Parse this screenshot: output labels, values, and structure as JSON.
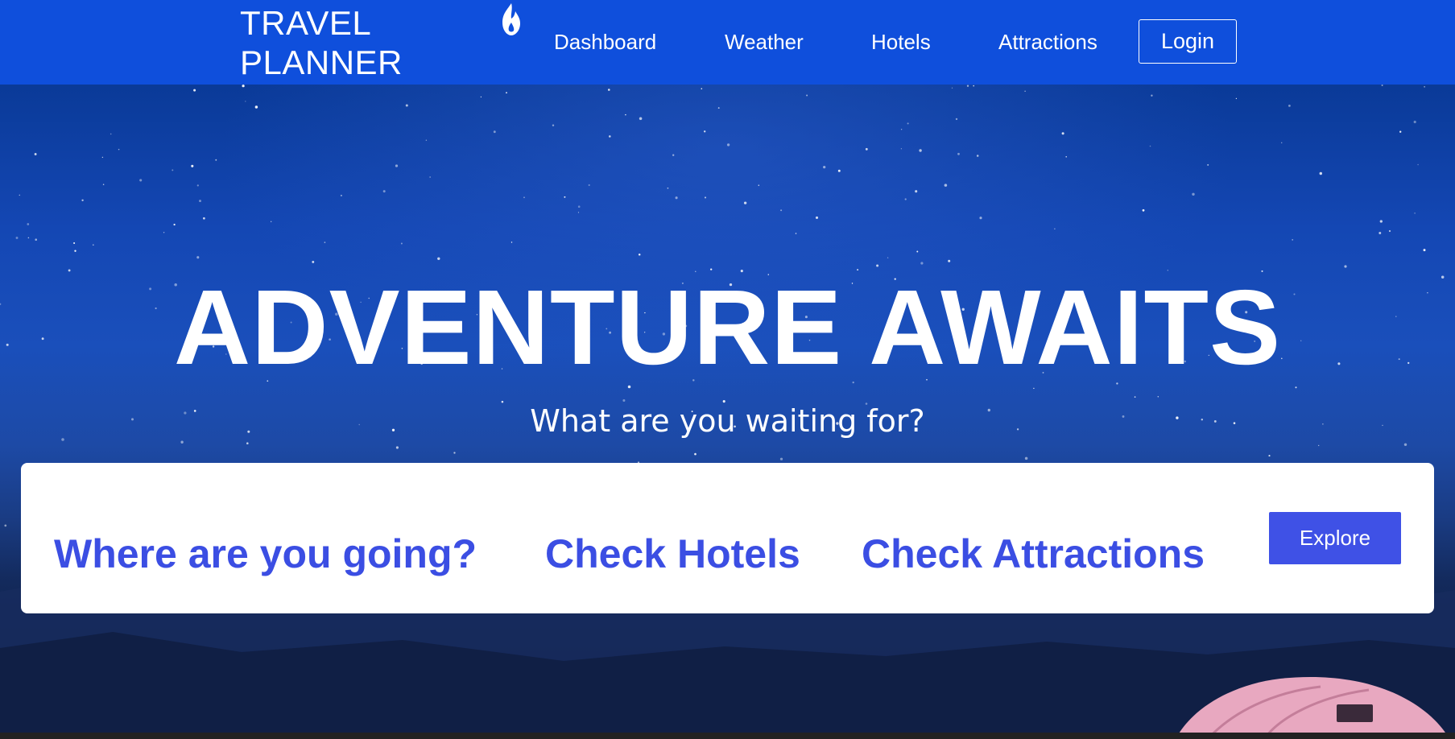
{
  "brand": {
    "line1": "TRAVEL",
    "line2": "PLANNER",
    "logo_icon": "flame-icon"
  },
  "nav": {
    "items": [
      {
        "label": "Dashboard"
      },
      {
        "label": "Weather"
      },
      {
        "label": "Hotels"
      },
      {
        "label": "Attractions"
      }
    ],
    "login_label": "Login"
  },
  "hero": {
    "title": "ADVENTURE AWAITS",
    "subtitle": "What are you waiting for?"
  },
  "search_card": {
    "items": [
      {
        "label": "Where are you going?"
      },
      {
        "label": "Check Hotels"
      },
      {
        "label": "Check Attractions"
      }
    ],
    "explore_label": "Explore"
  },
  "colors": {
    "navbar": "#0f4fdc",
    "accent": "#3f51e6",
    "card_text": "#3b4ee3",
    "hero_top": "#0a3a98",
    "hero_bottom": "#0c1a3a"
  }
}
